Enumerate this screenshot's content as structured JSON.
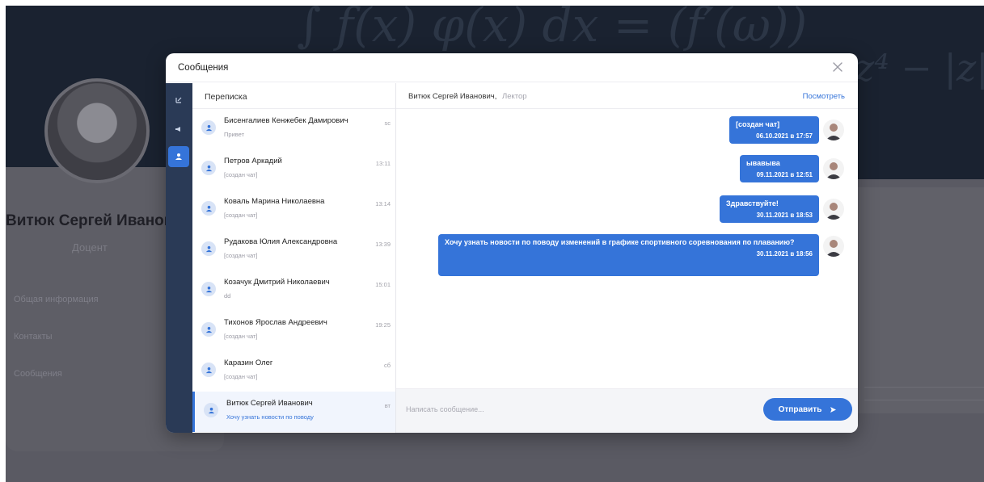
{
  "background": {
    "profile_name": "Витюк Сергей Иванов",
    "profile_role": "Доцент",
    "menu": [
      "Общая информация",
      "Контакты",
      "Сообщения"
    ]
  },
  "modal": {
    "title": "Сообщения",
    "close_icon": "close-icon"
  },
  "sidenav": {
    "items": [
      {
        "icon": "list-icon",
        "active": false
      },
      {
        "icon": "megaphone-icon",
        "active": false
      },
      {
        "icon": "users-icon",
        "active": true
      }
    ]
  },
  "conversations": {
    "header": "Переписка",
    "items": [
      {
        "name": "Бисенгалиев Кенжебек Дамирович",
        "preview": "Привет",
        "time": "sc"
      },
      {
        "name": "Петров Аркадий",
        "preview": "[создан чат]",
        "time": "13:11"
      },
      {
        "name": "Коваль Марина Николаевна",
        "preview": "[создан чат]",
        "time": "13:14"
      },
      {
        "name": "Рудакова Юлия Александровна",
        "preview": "[создан чат]",
        "time": "13:39"
      },
      {
        "name": "Козачук Дмитрий Николаевич",
        "preview": "dd",
        "time": "15:01"
      },
      {
        "name": "Тихонов Ярослав Андреевич",
        "preview": "[создан чат]",
        "time": "19:25"
      },
      {
        "name": "Каразин Олег",
        "preview": "[создан чат]",
        "time": "сб"
      },
      {
        "name": "Витюк Сергей Иванович",
        "preview": "Хочу узнать новости по поводу",
        "time": "вт"
      }
    ]
  },
  "chat": {
    "contact_name": "Витюк Сергей Иванович,",
    "contact_role": "Лектор",
    "view_label": "Посмотреть",
    "messages": [
      {
        "text": "[создан чат]",
        "time": "06.10.2021 в 17:57"
      },
      {
        "text": "ывавыва",
        "time": "09.11.2021 в 12:51"
      },
      {
        "text": "Здравствуйте!",
        "time": "30.11.2021 в 18:53"
      },
      {
        "text": "Хочу узнать новости по поводу изменений в графике спортивного соревнования по плаванию?",
        "time": "30.11.2021 в 18:56"
      }
    ],
    "input_placeholder": "Написать сообщение...",
    "send_label": "Отправить"
  },
  "colors": {
    "accent": "#3574d9",
    "sidenav": "#2a3a56",
    "overlay": "#5a5a63"
  }
}
